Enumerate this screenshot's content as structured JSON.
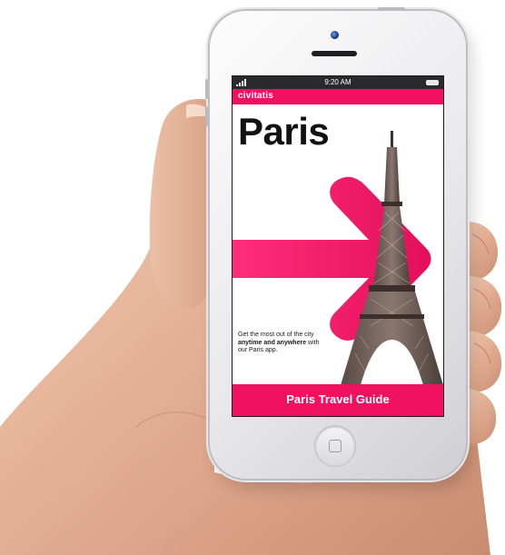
{
  "status_bar": {
    "time": "9:20 AM",
    "signal_icon": "signal-bars-icon",
    "battery_icon": "battery-icon"
  },
  "app": {
    "brand": "civitatis",
    "title": "Paris",
    "tagline_parts": [
      "Get the most out of the city ",
      "anytime and anywhere",
      " with our Paris app."
    ],
    "footer_button": "Paris Travel Guide"
  },
  "device": {
    "home_button_icon": "home-button-icon",
    "camera_icon": "front-camera-icon"
  },
  "colors": {
    "brand_pink": "#f0125f",
    "title_text": "#111111",
    "status_bar_bg": "#2a2a2e"
  }
}
